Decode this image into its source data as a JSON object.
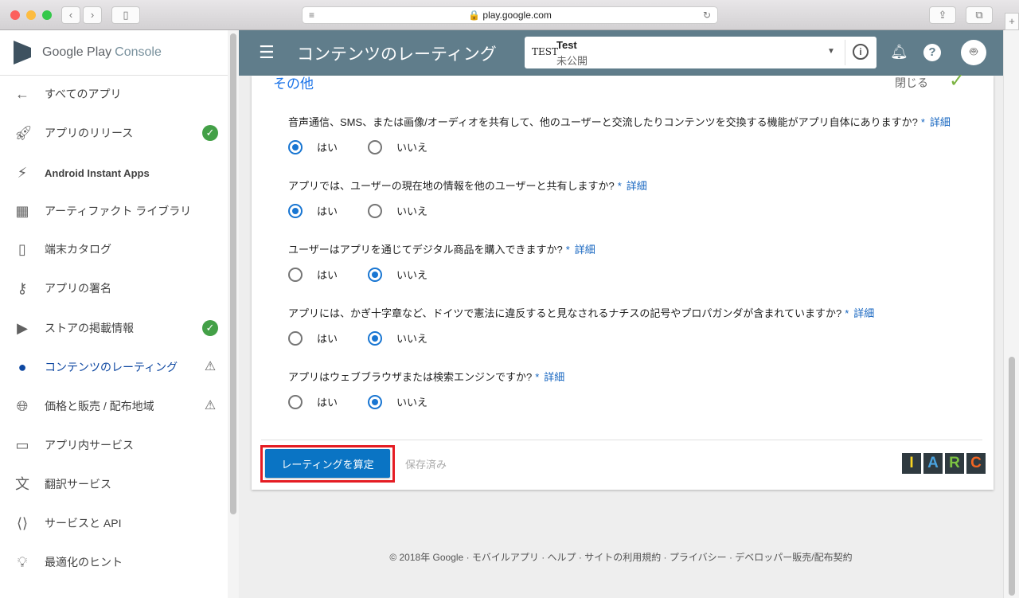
{
  "browser": {
    "url": "play.google.com"
  },
  "sidebar": {
    "logo_main": "Google Play",
    "logo_sub": "Console",
    "items": [
      {
        "label": "すべてのアプリ",
        "icon": "arrow-left-icon"
      },
      {
        "label": "アプリのリリース",
        "icon": "rocket-icon",
        "status": "check"
      },
      {
        "label": "Android Instant Apps",
        "icon": "bolt-icon"
      },
      {
        "label": "アーティファクト ライブラリ",
        "icon": "library-icon"
      },
      {
        "label": "端末カタログ",
        "icon": "device-icon"
      },
      {
        "label": "アプリの署名",
        "icon": "key-icon"
      },
      {
        "label": "ストアの掲載情報",
        "icon": "store-icon",
        "status": "check"
      },
      {
        "label": "コンテンツのレーティング",
        "icon": "rating-icon",
        "status": "warning",
        "active": true
      },
      {
        "label": "価格と販売 / 配布地域",
        "icon": "globe-icon",
        "status": "warning"
      },
      {
        "label": "アプリ内サービス",
        "icon": "card-icon"
      },
      {
        "label": "翻訳サービス",
        "icon": "translate-icon"
      },
      {
        "label": "サービスと API",
        "icon": "api-icon"
      },
      {
        "label": "最適化のヒント",
        "icon": "lightbulb-icon"
      }
    ]
  },
  "header": {
    "title": "コンテンツのレーティング",
    "app_logo": "TEST",
    "app_name": "Test",
    "app_status": "未公開"
  },
  "section": {
    "title": "その他",
    "close_label": "閉じる"
  },
  "questions": [
    {
      "text": "音声通信、SMS、または画像/オーディオを共有して、他のユーザーと交流したりコンテンツを交換する機能がアプリ自体にありますか?",
      "selected": "yes"
    },
    {
      "text": "アプリでは、ユーザーの現在地の情報を他のユーザーと共有しますか?",
      "selected": "yes"
    },
    {
      "text": "ユーザーはアプリを通じてデジタル商品を購入できますか?",
      "selected": "no"
    },
    {
      "text": "アプリには、かぎ十字章など、ドイツで憲法に違反すると見なされるナチスの記号やプロパガンダが含まれていますか?",
      "selected": "no"
    },
    {
      "text": "アプリはウェブブラウザまたは検索エンジンですか?",
      "selected": "no"
    }
  ],
  "labels": {
    "yes": "はい",
    "no": "いいえ",
    "required": "*",
    "details": "詳細"
  },
  "actions": {
    "calculate": "レーティングを算定",
    "saved": "保存済み"
  },
  "iarc": {
    "letters": [
      "I",
      "A",
      "R",
      "C"
    ],
    "colors": [
      "#f9d423",
      "#4aa3df",
      "#7cc242",
      "#f26522"
    ]
  },
  "footer": "© 2018年 Google · モバイルアプリ · ヘルプ · サイトの利用規約 · プライバシー · デベロッパー販売/配布契約"
}
